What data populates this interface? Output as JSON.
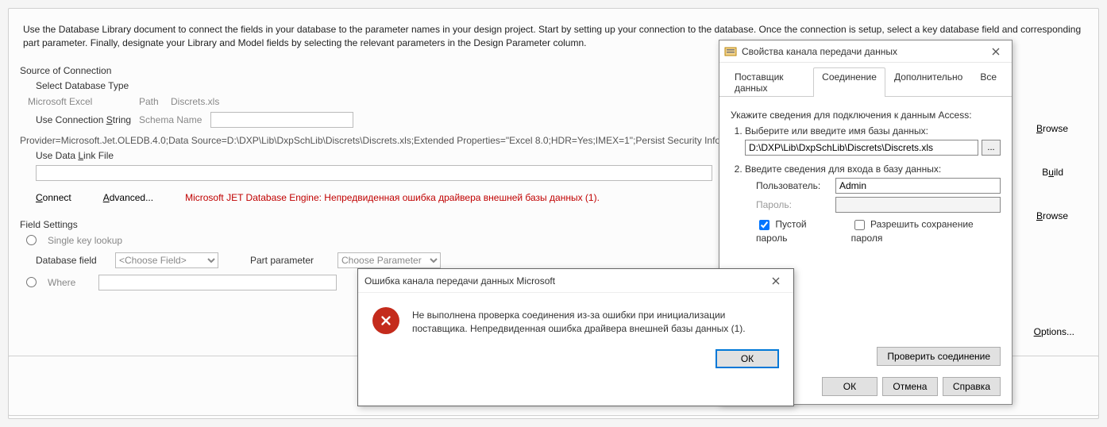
{
  "main": {
    "description": "Use the Database Library document to connect the fields in your database to the parameter names in your design project. Start by setting up your connection to the database. Once the connection is setup, select a key database field and corresponding part parameter. Finally, designate your Library and Model fields by selecting the relevant parameters in the Design Parameter column.",
    "source_section": "Source of Connection",
    "select_db_type": "Select Database Type",
    "provider_name": "Microsoft Excel",
    "path_label": "Path",
    "path_value": "Discrets.xls",
    "use_conn_string": "Use Connection String",
    "schema_name_label": "Schema Name",
    "connection_string": "Provider=Microsoft.Jet.OLEDB.4.0;Data Source=D:\\DXP\\Lib\\DxpSchLib\\Discrets\\Discrets.xls;Extended Properties=\"Excel 8.0;HDR=Yes;IMEX=1\";Persist Security Info=False",
    "use_data_link": "Use Data Link File",
    "connect_label": "Connect",
    "advanced_label": "Advanced...",
    "error_inline": "Microsoft JET Database Engine: Непредвиденная ошибка драйвера внешней базы данных (1).",
    "field_settings": "Field Settings",
    "single_key": "Single key lookup",
    "db_field_label": "Database field",
    "db_field_placeholder": "<Choose Field>",
    "part_param_label": "Part parameter",
    "part_param_placeholder": "Choose Parameter",
    "where_label": "Where",
    "browse_label": "Browse",
    "build_label": "Build",
    "options_label": "Options..."
  },
  "propDialog": {
    "title": "Свойства канала передачи данных",
    "tabs": {
      "provider": "Поставщик данных",
      "connection": "Соединение",
      "advanced": "Дополнительно",
      "all": "Все"
    },
    "intro": "Укажите сведения для подключения к данным Access:",
    "step1": "Выберите или введите имя базы данных:",
    "db_path": "D:\\DXP\\Lib\\DxpSchLib\\Discrets\\Discrets.xls",
    "browse_btn": "...",
    "step2": "Введите сведения для входа в базу данных:",
    "user_label": "Пользователь:",
    "user_value": "Admin",
    "pass_label": "Пароль:",
    "pass_value": "",
    "blank_pass": "Пустой пароль",
    "allow_save_pass": "Разрешить сохранение пароля",
    "test_conn": "Проверить соединение",
    "ok": "ОК",
    "cancel": "Отмена",
    "help": "Справка"
  },
  "errorDialog": {
    "title": "Ошибка канала передачи данных Microsoft",
    "message": "Не выполнена проверка соединения из-за ошибки при инициализации поставщика. Непредвиденная ошибка драйвера внешней базы данных (1).",
    "ok": "ОК"
  }
}
